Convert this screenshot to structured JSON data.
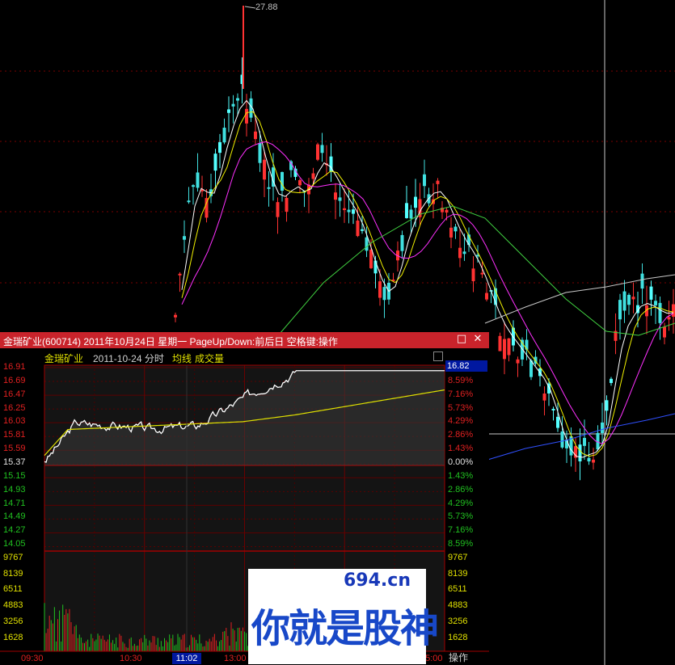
{
  "background_chart": {
    "high_label": "27.88"
  },
  "window": {
    "title": "金瑞矿业(600714) 2011年10月24日 星期一 PageUp/Down:前后日 空格键:操作",
    "maximize_icon": "□",
    "close_icon": "✕"
  },
  "info": {
    "name": "金瑞矿业",
    "date_mode": "2011-10-24 分时",
    "avg_label": "均线",
    "vol_label": "成交量"
  },
  "price_axis": {
    "left_up": [
      "16.91",
      "16.69",
      "16.47",
      "16.25",
      "16.03",
      "15.81",
      "15.59"
    ],
    "mid": "15.37",
    "left_down": [
      "15.15",
      "14.93",
      "14.71",
      "14.49",
      "14.27",
      "14.05"
    ],
    "right_up": [
      "8.59%",
      "7.16%",
      "5.73%",
      "4.29%",
      "2.86%",
      "1.43%"
    ],
    "right_mid": "0.00%",
    "right_down": [
      "1.43%",
      "2.86%",
      "4.29%",
      "5.73%",
      "7.16%",
      "8.59%"
    ],
    "last_price": "16.82"
  },
  "volume_axis": {
    "labels": [
      "9767",
      "8139",
      "6511",
      "4883",
      "3256",
      "1628"
    ]
  },
  "time_axis": {
    "labels": [
      "09:30",
      "10:30",
      "13:00",
      "15:00"
    ],
    "cursor": "11:02"
  },
  "operate_button": "操作",
  "watermark": {
    "url": "694.cn",
    "text": "你就是股神"
  },
  "colors": {
    "up": "#e02020",
    "down": "#20c020",
    "price_line": "#ffffff",
    "avg_line": "#e0e000",
    "titlebar": "#c9232b",
    "accent": "#0018a0"
  }
}
